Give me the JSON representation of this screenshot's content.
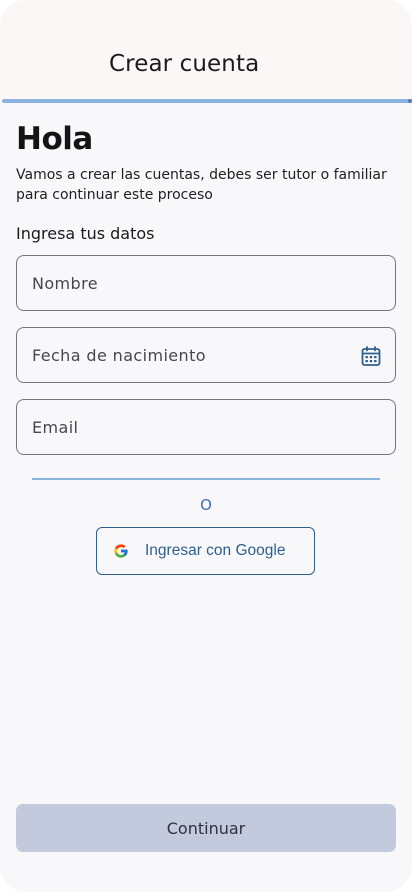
{
  "app_bar": {
    "title": "Crear cuenta",
    "progress": 1.0
  },
  "content": {
    "headline": "Hola",
    "description": "Vamos a crear las cuentas, debes ser tutor o familiar para continuar este proceso",
    "section_label": "Ingresa tus datos"
  },
  "form": {
    "name_placeholder": "Nombre",
    "birthdate_placeholder": "Fecha de nacimiento",
    "email_placeholder": "Email"
  },
  "alt_login": {
    "or_text": "O",
    "google_label": "Ingresar con Google"
  },
  "footer": {
    "continue_label": "Continuar"
  },
  "colors": {
    "accent": "#8ab4de",
    "primary_text": "#2f5f8a",
    "disabled_button": "#c3cadd"
  },
  "icons": {
    "calendar": "calendar-icon",
    "google": "google-icon"
  }
}
